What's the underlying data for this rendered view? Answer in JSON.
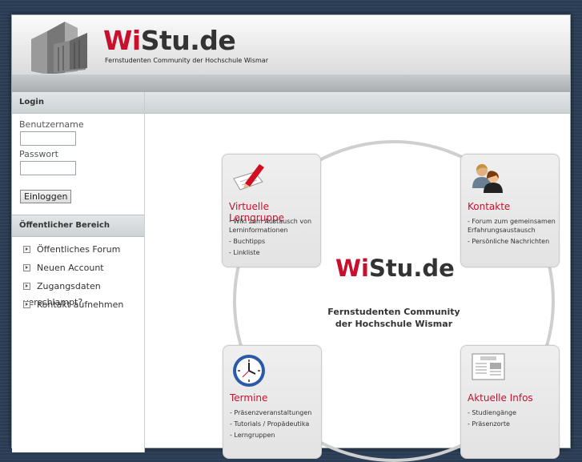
{
  "header": {
    "title_red": "Wi",
    "title_rest": "Stu.de",
    "subtitle": "Fernstudenten Community der Hochschule Wismar"
  },
  "sidebar": {
    "login_heading": "Login",
    "username_label": "Benutzername",
    "password_label": "Passwort",
    "login_button": "Einloggen",
    "public_heading": "Öffentlicher Bereich",
    "items": [
      {
        "label": "Öffentliches Forum"
      },
      {
        "label": "Neuen Account"
      },
      {
        "label": "Zugangsdaten verschlampt?"
      },
      {
        "label": "Kontakt aufnehmen"
      }
    ]
  },
  "main": {
    "center_title_red": "Wi",
    "center_title_rest": "Stu.de",
    "center_sub_line1": "Fernstudenten Community",
    "center_sub_line2": "der Hochschule Wismar",
    "boxes": [
      {
        "title": "Virtuelle Lerngruppe",
        "icon": "pencil-icon",
        "items": [
          "- Wiki zum Austausch von Lerninformationen",
          "- Buchtipps",
          "- Linkliste"
        ]
      },
      {
        "title": "Kontakte",
        "icon": "people-icon",
        "items": [
          "- Forum zum gemeinsamen Erfahrungsaustausch",
          "- Persönliche Nachrichten"
        ]
      },
      {
        "title": "Termine",
        "icon": "clock-icon",
        "items": [
          "- Präsenzveranstaltungen",
          "- Tutorials / Propädeutika",
          "- Lerngruppen"
        ]
      },
      {
        "title": "Aktuelle Infos",
        "icon": "newspaper-icon",
        "items": [
          "- Studiengänge",
          "- Präsenzorte"
        ]
      }
    ]
  },
  "colors": {
    "accent": "#c8102e",
    "background": "#2a3d55"
  }
}
